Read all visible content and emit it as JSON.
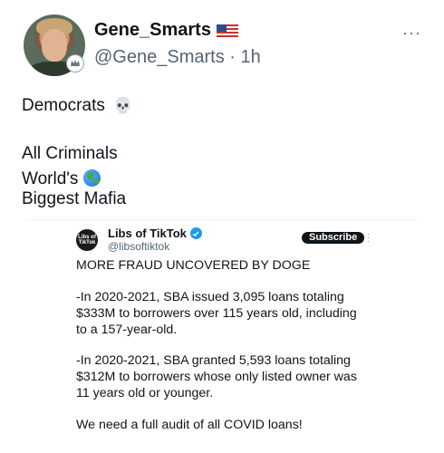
{
  "author": {
    "display_name": "Gene_Smarts",
    "handle": "@Gene_Smarts",
    "separator": "·",
    "time": "1h",
    "flag_icon": "us-flag-icon",
    "menu_icon": "···"
  },
  "post": {
    "line1": "Democrats",
    "line1_emoji": "skull-icon",
    "line2": "All Criminals",
    "line3_prefix": "World's",
    "line3_emoji": "globe-icon",
    "line4": "Biggest Mafia"
  },
  "embed": {
    "avatar_text": "Libs of TikTok",
    "name": "Libs of TikTok",
    "handle": "@libsoftiktok",
    "subscribe_label": "Subscribe",
    "lines": [
      "MORE FRAUD UNCOVERED BY DOGE",
      "-In 2020-2021, SBA issued 3,095 loans totaling",
      "$333M to borrowers over 115 years old, including",
      "to a 157-year-old.",
      "-In 2020-2021, SBA granted 5,593 loans totaling",
      "$312M to borrowers whose only listed owner was",
      "11 years old or younger.",
      "We need a full audit of all COVID loans!"
    ]
  },
  "colors": {
    "text": "#0f1419",
    "secondary": "#536471",
    "verified": "#1d9bf0",
    "subscribe_bg": "#0f1419"
  }
}
